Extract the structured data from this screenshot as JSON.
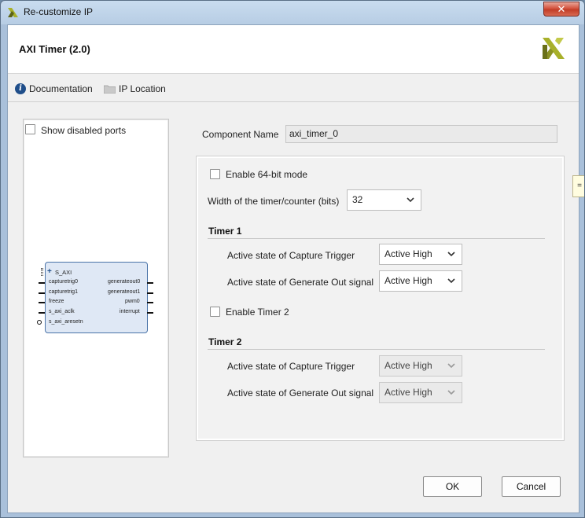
{
  "window": {
    "title": "Re-customize IP",
    "close_symbol": "✕"
  },
  "header": {
    "title": "AXI Timer (2.0)",
    "logo_icon": "xilinx-logo-icon"
  },
  "toolbar": {
    "documentation": "Documentation",
    "ip_location": "IP Location"
  },
  "left_panel": {
    "show_disabled_ports_label": "Show disabled ports",
    "show_disabled_ports_checked": false,
    "block": {
      "bus": "S_AXI",
      "left_ports": [
        "capturetrig0",
        "capturetrig1",
        "freeze",
        "s_axi_aclk",
        "s_axi_aresetn"
      ],
      "right_ports": [
        "generateout0",
        "generateout1",
        "pwm0",
        "interrupt"
      ]
    }
  },
  "form": {
    "component_name_label": "Component Name",
    "component_name_value": "axi_timer_0",
    "enable_64bit_label": "Enable 64-bit mode",
    "enable_64bit_checked": false,
    "width_label": "Width of the timer/counter (bits)",
    "width_value": "32",
    "timer1": {
      "title": "Timer 1",
      "capture_label": "Active state of Capture Trigger",
      "capture_value": "Active High",
      "generate_label": "Active state of Generate Out signal",
      "generate_value": "Active High"
    },
    "enable_timer2_label": "Enable Timer 2",
    "enable_timer2_checked": false,
    "timer2": {
      "title": "Timer 2",
      "capture_label": "Active state of Capture Trigger",
      "capture_value": "Active High",
      "generate_label": "Active state of Generate Out signal",
      "generate_value": "Active High"
    }
  },
  "buttons": {
    "ok": "OK",
    "cancel": "Cancel"
  },
  "colors": {
    "logo": "#a8b02a",
    "accent": "#1f4e8a"
  }
}
